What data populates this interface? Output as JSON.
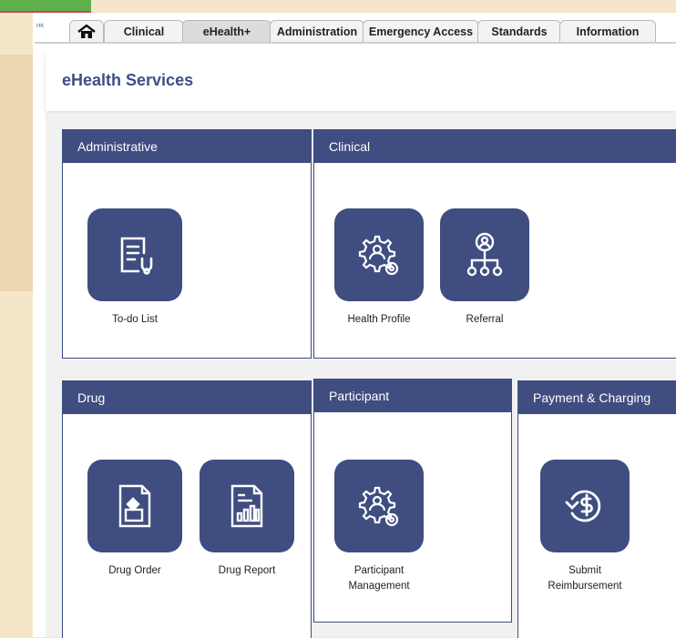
{
  "nav": {
    "logo_text": "HK",
    "tabs": [
      "Clinical",
      "eHealth+",
      "Administration",
      "Emergency Access",
      "Standards",
      "Information"
    ],
    "active_tab": "eHealth+"
  },
  "page": {
    "title": "eHealth Services"
  },
  "panels": {
    "administrative": {
      "title": "Administrative",
      "items": [
        "To-do List"
      ]
    },
    "clinical": {
      "title": "Clinical",
      "items": [
        "Health Profile",
        "Referral"
      ]
    },
    "drug": {
      "title": "Drug",
      "items": [
        "Drug Order",
        "Drug Report"
      ]
    },
    "participant": {
      "title": "Participant",
      "items": [
        "Participant Management"
      ]
    },
    "payment": {
      "title": "Payment & Charging",
      "items": [
        "Submit Reimbursement"
      ]
    }
  },
  "colors": {
    "accent": "#3f4d80",
    "title": "#3e4f83",
    "background": "#f1f1f1"
  }
}
